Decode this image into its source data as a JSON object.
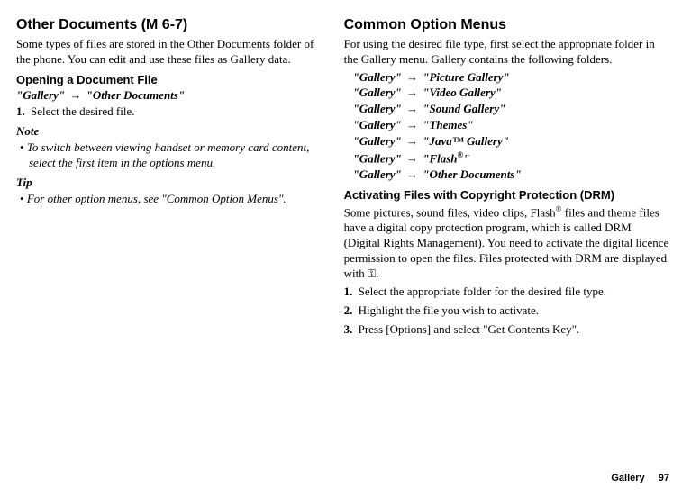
{
  "left": {
    "heading": "Other Documents (M 6-7)",
    "intro": "Some types of files are stored in the Other Documents folder of the phone. You can edit and use these files as Gallery data.",
    "subheading": "Opening a Document File",
    "path_a": "\"Gallery\"",
    "path_b": "\"Other Documents\"",
    "step1_num": "1.",
    "step1_text": "Select the desired file.",
    "note_label": "Note",
    "note_item": "To switch between viewing handset or memory card content, select the first item in the options menu.",
    "tip_label": "Tip",
    "tip_item": "For other option menus, see \"Common Option Menus\"."
  },
  "right": {
    "heading": "Common Option Menus",
    "intro": "For using the desired file type, first select the appropriate folder in the Gallery menu. Gallery contains the following folders.",
    "folders": {
      "g": "\"Gallery\"",
      "f1": "\"Picture Gallery\"",
      "f2": "\"Video Gallery\"",
      "f3": "\"Sound Gallery\"",
      "f4": "\"Themes\"",
      "f5a": "\"Java",
      "f5b": " Gallery\"",
      "f6a": "\"Flash",
      "f6b": "\"",
      "f7": "\"Other Documents\""
    },
    "drm_heading": "Activating Files with Copyright Protection (DRM)",
    "drm_text_a": "Some pictures, sound files, video clips, Flash",
    "drm_text_b": " files and theme files have a digital copy protection program, which is called DRM (Digital Rights Management). You need to activate the digital licence permission to open the files. Files protected with DRM are displayed with ",
    "drm_text_c": ".",
    "s1_num": "1.",
    "s1_text": "Select the appropriate folder for the desired file type.",
    "s2_num": "2.",
    "s2_text": "Highlight the file you wish to activate.",
    "s3_num": "3.",
    "s3_text": "Press [Options] and select \"Get Contents Key\"."
  },
  "symbols": {
    "arrow": "→",
    "tm": "™",
    "reg": "®",
    "key": "⚿"
  },
  "footer": {
    "label": "Gallery",
    "page": "97"
  }
}
